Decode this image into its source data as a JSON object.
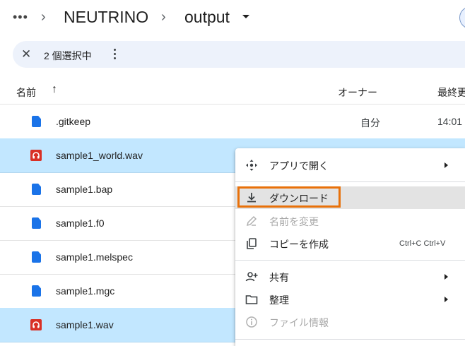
{
  "breadcrumb": {
    "more": "•••",
    "items": [
      "NEUTRINO",
      "output"
    ]
  },
  "selection": {
    "count_label": "2 個選択中"
  },
  "header": {
    "name": "名前",
    "owner": "オーナー",
    "modified": "最終更新"
  },
  "files": [
    {
      "name": ".gitkeep",
      "owner": "自分",
      "modified": "14:01",
      "icon": "doc-icon",
      "selected": false
    },
    {
      "name": "sample1_world.wav",
      "owner": "",
      "modified": "",
      "icon": "audio-icon",
      "selected": true
    },
    {
      "name": "sample1.bap",
      "owner": "",
      "modified": "",
      "icon": "doc-icon",
      "selected": false
    },
    {
      "name": "sample1.f0",
      "owner": "",
      "modified": "",
      "icon": "doc-icon",
      "selected": false
    },
    {
      "name": "sample1.melspec",
      "owner": "",
      "modified": "",
      "icon": "doc-icon",
      "selected": false
    },
    {
      "name": "sample1.mgc",
      "owner": "",
      "modified": "",
      "icon": "doc-icon",
      "selected": false
    },
    {
      "name": "sample1.wav",
      "owner": "",
      "modified": "",
      "icon": "audio-icon",
      "selected": true
    }
  ],
  "menu": {
    "open_with": "アプリで開く",
    "download": "ダウンロード",
    "rename": "名前を変更",
    "copy": "コピーを作成",
    "copy_shortcut": "Ctrl+C Ctrl+V",
    "share": "共有",
    "organize": "整理",
    "file_info": "ファイル情報"
  },
  "colors": {
    "selected_row": "#c2e7ff",
    "doc_icon": "#1a73e8",
    "audio_icon": "#d93025",
    "highlight_box": "#e8710a"
  }
}
